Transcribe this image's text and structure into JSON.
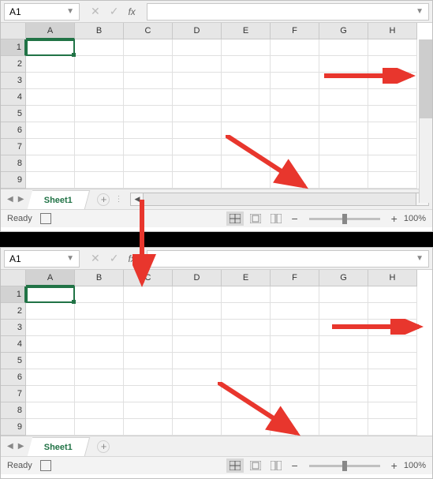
{
  "panels": {
    "top": {
      "namebox": "A1",
      "columns": [
        "A",
        "B",
        "C",
        "D",
        "E",
        "F",
        "G",
        "H"
      ],
      "rows": [
        "1",
        "2",
        "3",
        "4",
        "5",
        "6",
        "7",
        "8",
        "9"
      ],
      "sheet_tab": "Sheet1",
      "status": "Ready",
      "zoom": "100%",
      "has_hscroll": true
    },
    "bottom": {
      "namebox": "A1",
      "columns": [
        "A",
        "B",
        "C",
        "D",
        "E",
        "F",
        "G",
        "H"
      ],
      "rows": [
        "1",
        "2",
        "3",
        "4",
        "5",
        "6",
        "7",
        "8",
        "9"
      ],
      "sheet_tab": "Sheet1",
      "status": "Ready",
      "zoom": "100%",
      "has_hscroll": false
    }
  },
  "labels": {
    "fx": "fx",
    "new_sheet": "+"
  },
  "icons": {
    "cancel": "✕",
    "confirm": "✓",
    "dropdown": "▼",
    "left": "◀",
    "right": "▶",
    "minus": "−",
    "plus": "+"
  }
}
